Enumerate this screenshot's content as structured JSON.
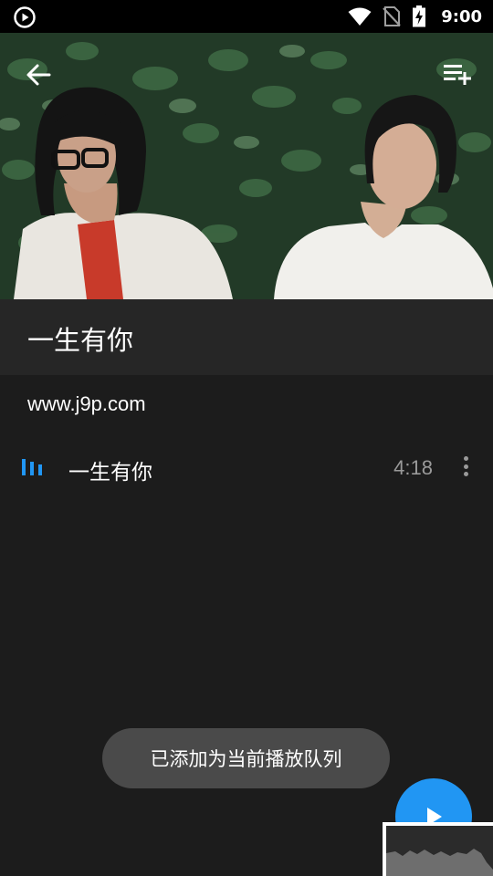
{
  "status_bar": {
    "time": "9:00",
    "icons": [
      "play-circle-icon",
      "wifi-icon",
      "no-sim-icon",
      "battery-charging-icon"
    ]
  },
  "header": {
    "back_icon": "arrow-back-icon",
    "add_playlist_icon": "playlist-add-icon"
  },
  "album": {
    "title": "一生有你",
    "subtitle": "www.j9p.com"
  },
  "tracks": [
    {
      "title": "一生有你",
      "duration": "4:18",
      "playing": true
    }
  ],
  "toast": {
    "message": "已添加为当前播放队列"
  },
  "colors": {
    "accent": "#2196f3",
    "background": "#1c1c1c",
    "title_bar": "#262626",
    "secondary_text": "#9a9a9a",
    "toast_bg": "#4a4a4a"
  }
}
